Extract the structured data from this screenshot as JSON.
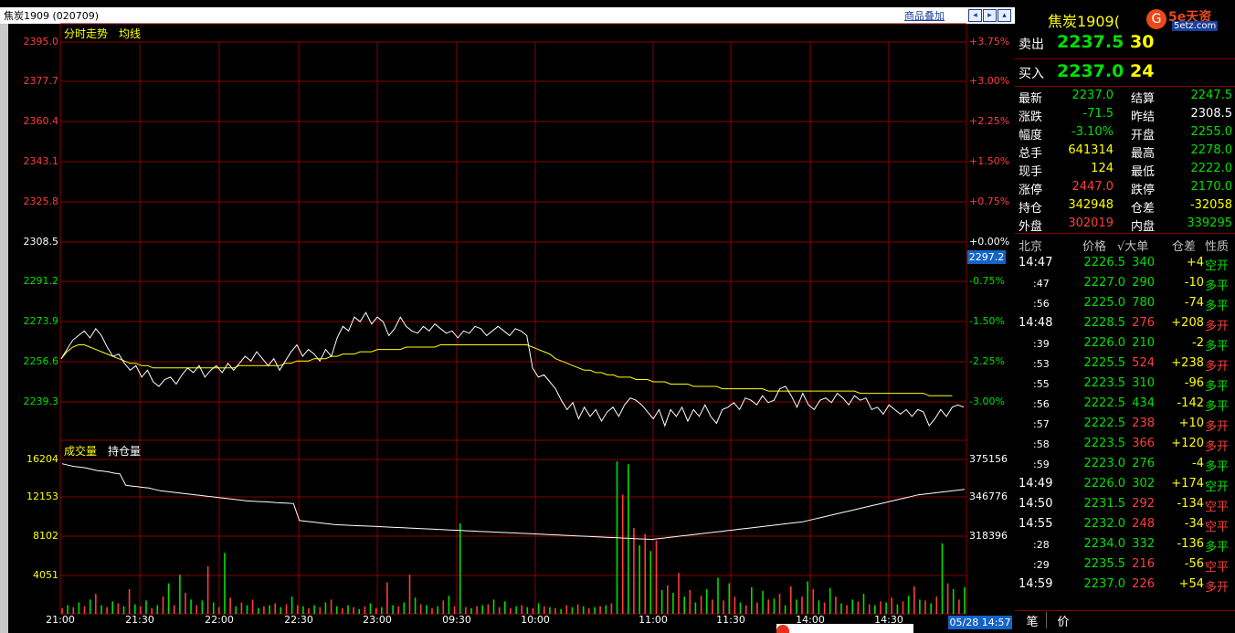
{
  "window": {
    "title": "焦炭1909 (020709)",
    "overlay_button": "商品叠加",
    "nav_icons": [
      "prev-icon",
      "next-icon",
      "expand-icon"
    ]
  },
  "chart_header": {
    "label1": "分时走势",
    "label2": "均线"
  },
  "volume_header": {
    "label1": "成交量",
    "label2": "持仓量"
  },
  "price_axis_left": [
    "2395.0",
    "2377.7",
    "2360.4",
    "2343.1",
    "2325.8",
    "2308.5",
    "2291.2",
    "2273.9",
    "2256.6",
    "2239.3"
  ],
  "price_axis_right": [
    "+3.75%",
    "+3.00%",
    "+2.25%",
    "+1.50%",
    "+0.75%",
    "+0.00%",
    "-0.75%",
    "-1.50%",
    "-2.25%",
    "-3.00%"
  ],
  "current_price_tag": "2297.2",
  "volume_axis_left": [
    "16204",
    "12153",
    "8102",
    "4051"
  ],
  "volume_axis_right": [
    "375156",
    "346776",
    "318396"
  ],
  "time_axis": [
    "21:00",
    "21:30",
    "22:00",
    "22:30",
    "23:00",
    "09:30",
    "10:00",
    "11:00",
    "11:30",
    "14:00",
    "14:30"
  ],
  "timestamp_tag": "05/28 14:57",
  "watermark_text": "5e天资",
  "watermark_sub": "5etz.com",
  "quote": {
    "name": "焦炭1909(",
    "ask_label": "卖出",
    "ask_price": "2237.5",
    "ask_vol": "30",
    "bid_label": "买入",
    "bid_price": "2237.0",
    "bid_vol": "24",
    "stats": [
      {
        "l1": "最新",
        "v1": "2237.0",
        "c1": "green",
        "l2": "结算",
        "v2": "2247.5",
        "c2": "green"
      },
      {
        "l1": "涨跌",
        "v1": "-71.5",
        "c1": "green",
        "l2": "昨结",
        "v2": "2308.5",
        "c2": "white"
      },
      {
        "l1": "幅度",
        "v1": "-3.10%",
        "c1": "green",
        "l2": "开盘",
        "v2": "2255.0",
        "c2": "green"
      },
      {
        "l1": "总手",
        "v1": "641314",
        "c1": "yellow",
        "l2": "最高",
        "v2": "2278.0",
        "c2": "green"
      },
      {
        "l1": "现手",
        "v1": "124",
        "c1": "yellow",
        "l2": "最低",
        "v2": "2222.0",
        "c2": "green"
      },
      {
        "l1": "涨停",
        "v1": "2447.0",
        "c1": "red",
        "l2": "跌停",
        "v2": "2170.0",
        "c2": "green"
      },
      {
        "l1": "持仓",
        "v1": "342948",
        "c1": "yellow",
        "l2": "仓差",
        "v2": "-32058",
        "c2": "yellow"
      },
      {
        "l1": "外盘",
        "v1": "302019",
        "c1": "red",
        "l2": "内盘",
        "v2": "339295",
        "c2": "green"
      }
    ],
    "trade_header": {
      "loc": "北京",
      "price": "价格",
      "big": "√大单",
      "diff": "仓差",
      "nature": "性质"
    },
    "trades": [
      {
        "time": "14:47",
        "price": "2226.5",
        "pc": "green",
        "vol": "340",
        "vc": "green",
        "diff": "+4",
        "dc": "yellow",
        "nature": "空开",
        "nc": "green",
        "major": true
      },
      {
        "time": ":47",
        "price": "2227.0",
        "pc": "green",
        "vol": "290",
        "vc": "green",
        "diff": "-10",
        "dc": "yellow",
        "nature": "多平",
        "nc": "green",
        "major": false
      },
      {
        "time": ":56",
        "price": "2225.0",
        "pc": "green",
        "vol": "780",
        "vc": "green",
        "diff": "-74",
        "dc": "yellow",
        "nature": "多平",
        "nc": "green",
        "major": false
      },
      {
        "time": "14:48",
        "price": "2228.5",
        "pc": "green",
        "vol": "276",
        "vc": "red",
        "diff": "+208",
        "dc": "yellow",
        "nature": "多开",
        "nc": "red",
        "major": true
      },
      {
        "time": ":39",
        "price": "2226.0",
        "pc": "green",
        "vol": "210",
        "vc": "green",
        "diff": "-2",
        "dc": "yellow",
        "nature": "多平",
        "nc": "green",
        "major": false
      },
      {
        "time": ":53",
        "price": "2225.5",
        "pc": "green",
        "vol": "524",
        "vc": "red",
        "diff": "+238",
        "dc": "yellow",
        "nature": "多开",
        "nc": "red",
        "major": false
      },
      {
        "time": ":55",
        "price": "2223.5",
        "pc": "green",
        "vol": "310",
        "vc": "green",
        "diff": "-96",
        "dc": "yellow",
        "nature": "多平",
        "nc": "green",
        "major": false
      },
      {
        "time": ":56",
        "price": "2222.5",
        "pc": "green",
        "vol": "434",
        "vc": "green",
        "diff": "-142",
        "dc": "yellow",
        "nature": "多平",
        "nc": "green",
        "major": false
      },
      {
        "time": ":57",
        "price": "2222.5",
        "pc": "green",
        "vol": "238",
        "vc": "red",
        "diff": "+10",
        "dc": "yellow",
        "nature": "多开",
        "nc": "red",
        "major": false
      },
      {
        "time": ":58",
        "price": "2223.5",
        "pc": "green",
        "vol": "366",
        "vc": "red",
        "diff": "+120",
        "dc": "yellow",
        "nature": "多开",
        "nc": "red",
        "major": false
      },
      {
        "time": ":59",
        "price": "2223.0",
        "pc": "green",
        "vol": "276",
        "vc": "green",
        "diff": "-4",
        "dc": "yellow",
        "nature": "多平",
        "nc": "green",
        "major": false
      },
      {
        "time": "14:49",
        "price": "2226.0",
        "pc": "green",
        "vol": "302",
        "vc": "green",
        "diff": "+174",
        "dc": "yellow",
        "nature": "空开",
        "nc": "green",
        "major": true
      },
      {
        "time": "14:50",
        "price": "2231.5",
        "pc": "green",
        "vol": "292",
        "vc": "red",
        "diff": "-134",
        "dc": "yellow",
        "nature": "空平",
        "nc": "red",
        "major": true
      },
      {
        "time": "14:55",
        "price": "2232.0",
        "pc": "green",
        "vol": "248",
        "vc": "red",
        "diff": "-34",
        "dc": "yellow",
        "nature": "空平",
        "nc": "red",
        "major": true
      },
      {
        "time": ":28",
        "price": "2234.0",
        "pc": "green",
        "vol": "332",
        "vc": "green",
        "diff": "-136",
        "dc": "yellow",
        "nature": "多平",
        "nc": "green",
        "major": false
      },
      {
        "time": ":29",
        "price": "2235.5",
        "pc": "green",
        "vol": "216",
        "vc": "red",
        "diff": "-56",
        "dc": "yellow",
        "nature": "空平",
        "nc": "red",
        "major": false
      },
      {
        "time": "14:59",
        "price": "2237.0",
        "pc": "green",
        "vol": "226",
        "vc": "red",
        "diff": "+54",
        "dc": "yellow",
        "nature": "多开",
        "nc": "red",
        "major": true
      }
    ],
    "tabs": [
      "笔",
      "价"
    ]
  },
  "colors": {
    "grid": "#8a0000",
    "up": "#ff3c3c",
    "down": "#00e000",
    "avg": "#ffff00",
    "price": "#ffffff",
    "hold": "#ffffff"
  },
  "chart_data": {
    "type": "line",
    "title": "",
    "price_ylim": [
      2230.65,
      2395.0
    ],
    "prev_settle": 2308.5,
    "price_series": [
      2258,
      2262,
      2266,
      2268,
      2270,
      2267,
      2271,
      2268,
      2263,
      2259,
      2260,
      2256,
      2253,
      2255,
      2250,
      2253,
      2248,
      2246,
      2249,
      2250,
      2247,
      2251,
      2254,
      2252,
      2255,
      2250,
      2253,
      2255,
      2252,
      2256,
      2253,
      2256,
      2259,
      2257,
      2261,
      2258,
      2255,
      2258,
      2253,
      2257,
      2261,
      2264,
      2259,
      2262,
      2260,
      2257,
      2262,
      2259,
      2267,
      2272,
      2270,
      2276,
      2274,
      2278,
      2273,
      2276,
      2274,
      2268,
      2271,
      2276,
      2272,
      2270,
      2269,
      2272,
      2270,
      2273,
      2271,
      2269,
      2270,
      2267,
      2270,
      2269,
      2272,
      2271,
      2268,
      2270,
      2272,
      2270,
      2268,
      2271,
      2270,
      2268,
      2254,
      2250,
      2251,
      2248,
      2245,
      2240,
      2236,
      2239,
      2232,
      2237,
      2233,
      2236,
      2231,
      2235,
      2237,
      2233,
      2238,
      2241,
      2240,
      2238,
      2235,
      2232,
      2236,
      2229,
      2236,
      2233,
      2237,
      2231,
      2236,
      2233,
      2238,
      2233,
      2230,
      2236,
      2237,
      2239,
      2236,
      2241,
      2240,
      2238,
      2242,
      2239,
      2240,
      2245,
      2246,
      2242,
      2237,
      2243,
      2238,
      2236,
      2240,
      2241,
      2239,
      2243,
      2241,
      2238,
      2242,
      2240,
      2241,
      2236,
      2237,
      2234,
      2238,
      2236,
      2234,
      2236,
      2233,
      2236,
      2235,
      2229,
      2232,
      2236,
      2233,
      2237,
      2238,
      2237
    ],
    "avg_series": [
      2258,
      2261,
      2263,
      2264,
      2264,
      2263,
      2262,
      2261,
      2260,
      2259,
      2258,
      2257,
      2256,
      2256,
      2255,
      2255,
      2254,
      2254,
      2254,
      2254,
      2254,
      2254,
      2254,
      2254,
      2254,
      2254,
      2254,
      2254,
      2254,
      2254,
      2254,
      2255,
      2255,
      2255,
      2255,
      2255,
      2255,
      2255,
      2255,
      2256,
      2256,
      2257,
      2257,
      2257,
      2258,
      2258,
      2258,
      2259,
      2259,
      2260,
      2260,
      2260,
      2261,
      2261,
      2261,
      2262,
      2262,
      2262,
      2262,
      2262,
      2263,
      2263,
      2263,
      2263,
      2263,
      2263,
      2264,
      2264,
      2264,
      2264,
      2264,
      2264,
      2264,
      2264,
      2264,
      2264,
      2264,
      2264,
      2264,
      2264,
      2264,
      2264,
      2263,
      2262,
      2261,
      2260,
      2258,
      2257,
      2256,
      2255,
      2254,
      2253,
      2253,
      2252,
      2252,
      2251,
      2251,
      2250,
      2250,
      2250,
      2249,
      2249,
      2249,
      2248,
      2248,
      2248,
      2247,
      2247,
      2247,
      2247,
      2246,
      2246,
      2246,
      2246,
      2246,
      2245,
      2245,
      2245,
      2245,
      2245,
      2245,
      2245,
      2245,
      2244,
      2244,
      2244,
      2244,
      2244,
      2244,
      2244,
      2244,
      2244,
      2244,
      2244,
      2244,
      2244,
      2244,
      2244,
      2244,
      2243,
      2243,
      2243,
      2243,
      2243,
      2243,
      2243,
      2243,
      2243,
      2243,
      2243,
      2243,
      2242,
      2242,
      2242,
      2242,
      2242
    ],
    "volume_ylim": [
      0,
      16204
    ],
    "volume_series": [
      600,
      900,
      700,
      1200,
      800,
      1500,
      2100,
      900,
      700,
      1300,
      1100,
      800,
      2600,
      1000,
      800,
      1400,
      600,
      900,
      1800,
      3200,
      900,
      4100,
      2200,
      1500,
      900,
      1400,
      5000,
      1200,
      700,
      6400,
      1700,
      800,
      1200,
      900,
      1500,
      600,
      800,
      900,
      1100,
      700,
      1000,
      1800,
      900,
      800,
      600,
      900,
      700,
      1200,
      1500,
      800,
      600,
      900,
      700,
      500,
      800,
      1100,
      600,
      700,
      3300,
      900,
      800,
      1200,
      4100,
      1700,
      1000,
      900,
      600,
      800,
      1400,
      1900,
      800,
      9500,
      700,
      600,
      800,
      900,
      1000,
      1500,
      700,
      1300,
      600,
      800,
      900,
      700,
      600,
      1100,
      800,
      700,
      600,
      500,
      900,
      700,
      1000,
      800,
      600,
      700,
      800,
      900,
      1100,
      16000,
      12500,
      15700,
      9000,
      7200,
      8400,
      6600,
      7700,
      2500,
      3000,
      2200,
      4300,
      1800,
      2500,
      1200,
      1900,
      2600,
      1500,
      3800,
      1400,
      3200,
      1800,
      1200,
      900,
      2800,
      1200,
      2400,
      1500,
      1600,
      2100,
      900,
      2900,
      1500,
      1800,
      3400,
      2600,
      1400,
      1200,
      2700,
      1800,
      1100,
      900,
      1500,
      1300,
      2100,
      1000,
      900,
      1300,
      1200,
      1700,
      1000,
      1300,
      1900,
      2900,
      1500,
      1400,
      1100,
      1800,
      7400,
      3200,
      2600,
      1500,
      2800
    ],
    "volume_colors": "alternating red/green per bar",
    "hold_ylim": [
      300000,
      375156
    ],
    "hold_series": [
      372000,
      371000,
      370000,
      369500,
      369000,
      368000,
      367000,
      366500,
      366000,
      365000,
      364500,
      356000,
      355500,
      355000,
      354500,
      354000,
      353000,
      352000,
      351500,
      351000,
      350500,
      350000,
      349500,
      349000,
      348500,
      348000,
      347500,
      347000,
      346500,
      346000,
      345500,
      345000,
      344500,
      344200,
      344000,
      343800,
      343500,
      343200,
      343000,
      342800,
      342500,
      330000,
      329500,
      329000,
      328500,
      328000,
      327500,
      327000,
      326800,
      326600,
      326400,
      326200,
      326000,
      325800,
      325600,
      325400,
      325200,
      325000,
      324800,
      324600,
      324400,
      324200,
      324000,
      323800,
      323600,
      323400,
      323200,
      323000,
      322800,
      322600,
      322400,
      322200,
      322000,
      321800,
      321600,
      321400,
      321200,
      321000,
      320800,
      320600,
      320400,
      320200,
      320000,
      319800,
      319600,
      319400,
      319200,
      319000,
      318800,
      318600,
      318400,
      318200,
      318000,
      317800,
      317600,
      317400,
      317200,
      317000,
      316800,
      316600,
      316400,
      316200,
      316000,
      316500,
      317000,
      317500,
      318000,
      318500,
      319000,
      319500,
      320000,
      320500,
      321000,
      321500,
      322000,
      322500,
      323000,
      323500,
      324000,
      324500,
      325000,
      325500,
      326000,
      326500,
      327000,
      327500,
      328000,
      328500,
      329000,
      330000,
      331000,
      332000,
      333000,
      334000,
      335000,
      336000,
      337000,
      338000,
      339000,
      340000,
      341000,
      342000,
      343000,
      344000,
      345000,
      346000,
      347000,
      348000,
      349000,
      349500,
      350000,
      350500,
      351000,
      351500,
      352000,
      352500,
      353000
    ],
    "xlabel": "",
    "ylabel": ""
  }
}
